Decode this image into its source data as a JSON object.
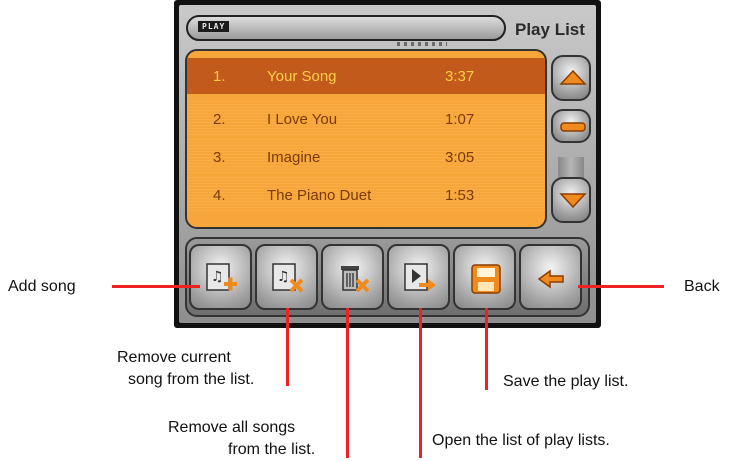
{
  "header": {
    "tag_text": "PLAY",
    "title": "Play List"
  },
  "songs": [
    {
      "number": "1.",
      "title": "Your Song",
      "duration": "3:37"
    },
    {
      "number": "2.",
      "title": "I Love You",
      "duration": "1:07"
    },
    {
      "number": "3.",
      "title": "Imagine",
      "duration": "3:05"
    },
    {
      "number": "4.",
      "title": "The Piano Duet",
      "duration": "1:53"
    }
  ],
  "controls": {
    "scroll_up": "up-arrow-icon",
    "scroll_thumb": "scroll-thumb-icon",
    "scroll_down": "down-arrow-icon"
  },
  "toolbar": [
    "add-song-icon",
    "remove-song-icon",
    "remove-all-icon",
    "open-playlists-icon",
    "save-playlist-icon",
    "back-arrow-icon"
  ],
  "callouts": {
    "add_song": "Add song",
    "remove_current_1": "Remove current",
    "remove_current_2": "song from the list.",
    "remove_all_1": "Remove all songs",
    "remove_all_2": "from the list.",
    "open_lists": "Open the list of play lists.",
    "save": "Save the play list.",
    "back": "Back"
  },
  "colors": {
    "list_bg": "#f7a73a",
    "selected_row": "#c25a1b",
    "accent_orange": "#f08a1c",
    "callout_line": "#ee2222"
  }
}
